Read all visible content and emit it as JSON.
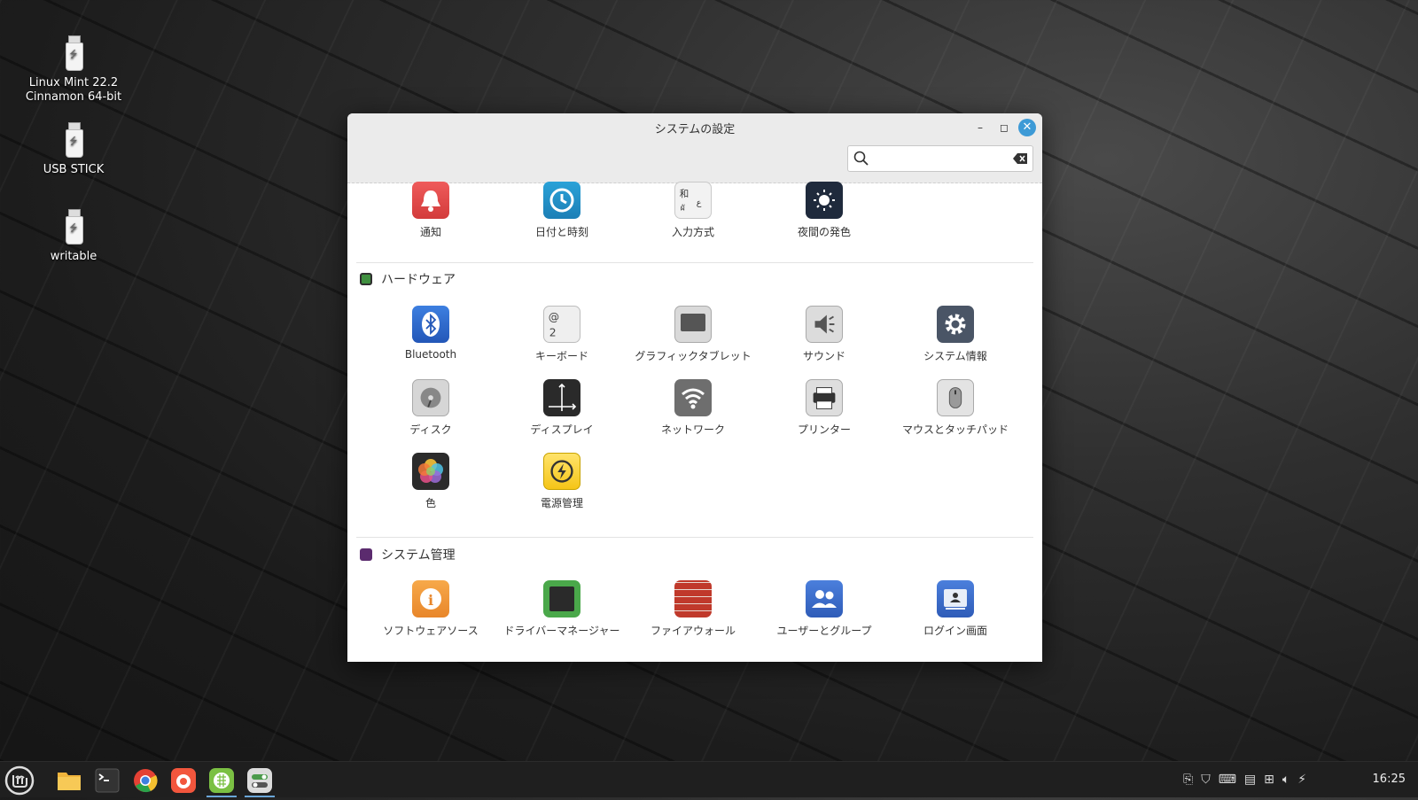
{
  "desktop": {
    "icons": [
      {
        "label": "Linux Mint 22.2\nCinnamon 64-bit",
        "line1": "Linux Mint 22.2",
        "line2": "Cinnamon 64-bit"
      },
      {
        "label": "USB STICK"
      },
      {
        "label": "writable"
      }
    ]
  },
  "window": {
    "title": "システムの設定",
    "search": {
      "value": "",
      "placeholder": ""
    }
  },
  "sections": {
    "top_row": [
      {
        "label": "通知",
        "icon": "notification-bell-icon"
      },
      {
        "label": "日付と時刻",
        "icon": "clock-icon"
      },
      {
        "label": "入力方式",
        "icon": "input-method-icon"
      },
      {
        "label": "夜間の発色",
        "icon": "night-light-icon"
      }
    ],
    "hardware": {
      "title": "ハードウェア",
      "items": [
        {
          "label": "Bluetooth",
          "icon": "bluetooth-icon"
        },
        {
          "label": "キーボード",
          "icon": "keyboard-icon"
        },
        {
          "label": "グラフィックタブレット",
          "icon": "graphics-tablet-icon"
        },
        {
          "label": "サウンド",
          "icon": "sound-icon"
        },
        {
          "label": "システム情報",
          "icon": "system-info-gear-icon"
        },
        {
          "label": "ディスク",
          "icon": "disk-icon"
        },
        {
          "label": "ディスプレイ",
          "icon": "display-icon"
        },
        {
          "label": "ネットワーク",
          "icon": "network-wifi-icon"
        },
        {
          "label": "プリンター",
          "icon": "printer-icon"
        },
        {
          "label": "マウスとタッチパッド",
          "icon": "mouse-icon"
        },
        {
          "label": "色",
          "icon": "color-icon"
        },
        {
          "label": "電源管理",
          "icon": "power-icon"
        }
      ]
    },
    "admin": {
      "title": "システム管理",
      "items": [
        {
          "label": "ソフトウェアソース",
          "icon": "software-sources-icon"
        },
        {
          "label": "ドライバーマネージャー",
          "icon": "driver-manager-icon"
        },
        {
          "label": "ファイアウォール",
          "icon": "firewall-icon"
        },
        {
          "label": "ユーザーとグループ",
          "icon": "users-groups-icon"
        },
        {
          "label": "ログイン画面",
          "icon": "login-window-icon"
        }
      ]
    }
  },
  "taskbar": {
    "apps": [
      "mint-menu-icon",
      "files-folder-icon",
      "terminal-icon",
      "chrome-icon",
      "firefox-icon",
      "spreadsheet-icon",
      "settings-icon"
    ],
    "clock": "16:25"
  },
  "colors": {
    "accent": "#3d9ad6",
    "taskbar": "#1f1f1f"
  }
}
